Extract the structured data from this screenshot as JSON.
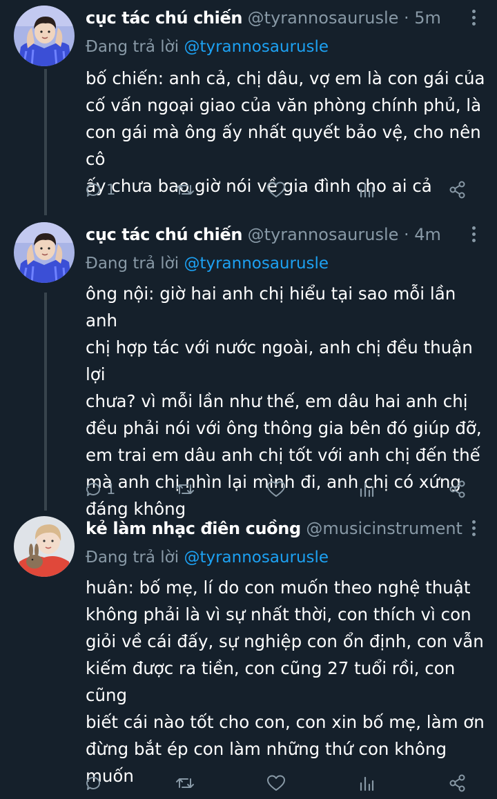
{
  "tweets": [
    {
      "name": "cục tác chú chiến",
      "handle": "@tyrannosaurusle",
      "time": "· 5m",
      "replying_label": "Đang trả lời",
      "replying_to": "@tyrannosaurusle",
      "text": "bố chiến: anh cả, chị dâu, vợ em là con gái của\ncố vấn ngoại giao của văn phòng chính phủ, là\ncon gái mà ông ấy nhất quyết bảo vệ, cho nên cô\nấy chưa bao giờ nói về gia đình cho ai cả",
      "reply_count": "1",
      "avatar": "boy-with-blue-sweater"
    },
    {
      "name": "cục tác chú chiến",
      "handle": "@tyrannosaurusle",
      "time": "· 4m",
      "replying_label": "Đang trả lời",
      "replying_to": "@tyrannosaurusle",
      "text": "ông nội: giờ hai anh chị hiểu tại sao mỗi lần anh\nchị hợp tác với nước ngoài, anh chị đều thuận lợi\nchưa? vì mỗi lần như thế, em dâu hai anh chị\nđều phải nói với ông thông gia bên đó giúp đỡ,\nem trai em dâu anh chị tốt với anh chị đến thế\nmà anh chị nhìn lại mình đi, anh chị có xứng\nđáng không",
      "reply_count": "1",
      "avatar": "boy-with-blue-sweater"
    },
    {
      "name": "kẻ làm nhạc điên cuồng",
      "handle": "@musicinstrument ...",
      "time": "",
      "replying_label": "Đang trả lời",
      "replying_to": "@tyrannosaurusle",
      "text": "huân: bố mẹ, lí do con muốn theo nghệ thuật\nkhông phải là vì sự nhất thời, con thích vì con\ngiỏi về cái đấy, sự nghiệp con ổn định, con vẫn\nkiếm được ra tiền, con cũng 27 tuổi rồi, con cũng\nbiết cái nào tốt cho con, con xin bố mẹ, làm ơn\nđừng bắt ép con làm những thứ con không\nmuốn",
      "reply_count": "",
      "avatar": "person-with-rabbit"
    }
  ],
  "colors": {
    "background": "#15202b",
    "text": "#ffffff",
    "muted": "#8899a6",
    "link": "#1da1f2",
    "thread_line": "#38444d"
  },
  "icons": [
    "reply-icon",
    "retweet-icon",
    "like-icon",
    "analytics-icon",
    "share-icon",
    "more-icon"
  ]
}
